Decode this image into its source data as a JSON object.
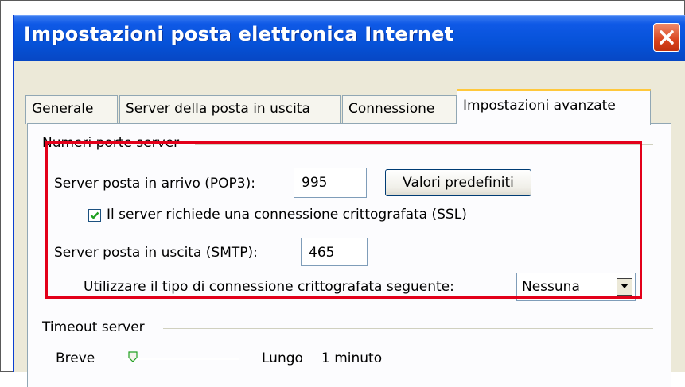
{
  "window": {
    "title": "Impostazioni posta elettronica Internet"
  },
  "tabs": [
    {
      "label": "Generale"
    },
    {
      "label": "Server della posta in uscita"
    },
    {
      "label": "Connessione"
    },
    {
      "label": "Impostazioni avanzate",
      "active": true
    }
  ],
  "server_ports": {
    "group_label": "Numeri porte server",
    "incoming_label": "Server posta in arrivo (POP3):",
    "incoming_value": "995",
    "defaults_button": "Valori predefiniti",
    "ssl_checkbox_label": "Il server richiede una connessione crittografata (SSL)",
    "ssl_checked": true,
    "outgoing_label": "Server posta in uscita (SMTP):",
    "outgoing_value": "465",
    "encryption_label": "Utilizzare il tipo di connessione crittografata seguente:",
    "encryption_value": "Nessuna"
  },
  "timeout": {
    "group_label": "Timeout server",
    "short_label": "Breve",
    "long_label": "Lungo",
    "value": "1 minuto",
    "slider_fraction": 0.1
  },
  "colors": {
    "highlight_box": "#e3001a",
    "titlebar": "#0652d8",
    "active_tab_accent": "#ffc83c"
  }
}
